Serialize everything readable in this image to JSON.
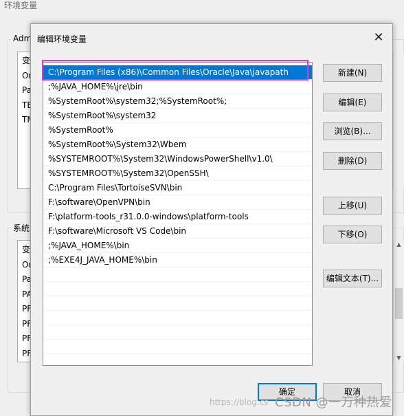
{
  "background_window": {
    "title": "环境变量",
    "user_group_label": "Adm",
    "user_list": [
      "变",
      "Or",
      "Pa",
      "TE",
      "TM"
    ],
    "system_group_label": "系统",
    "system_list": [
      "变",
      "Or",
      "Pa",
      "PA",
      "PF",
      "PF",
      "PF",
      "PF"
    ]
  },
  "dialog": {
    "title": "编辑环境变量",
    "close_glyph": "✕",
    "paths": [
      "C:\\Program Files (x86)\\Common Files\\Oracle\\Java\\javapath",
      ";%JAVA_HOME%\\jre\\bin",
      "%SystemRoot%\\system32;%SystemRoot%;",
      "%SystemRoot%\\system32",
      "%SystemRoot%",
      "%SystemRoot%\\System32\\Wbem",
      "%SYSTEMROOT%\\System32\\WindowsPowerShell\\v1.0\\",
      "%SYSTEMROOT%\\System32\\OpenSSH\\",
      "C:\\Program Files\\TortoiseSVN\\bin",
      "F:\\software\\OpenVPN\\bin",
      "F:\\platform-tools_r31.0.0-windows\\platform-tools",
      "F:\\software\\Microsoft VS Code\\bin",
      ";%JAVA_HOME%\\bin",
      ";%EXE4J_JAVA_HOME%\\bin",
      "",
      "",
      "",
      "",
      "",
      ""
    ],
    "buttons": {
      "new": "新建(N)",
      "edit": "编辑(E)",
      "browse": "浏览(B)...",
      "delete": "删除(D)",
      "move_up": "上移(U)",
      "move_down": "下移(O)",
      "edit_text": "编辑文本(T)...",
      "ok": "确定",
      "cancel": "取消"
    }
  },
  "watermark": {
    "url": "https://blog.cs",
    "text": "CSDN @一万种热爱"
  },
  "colors": {
    "selection": "#0078d7",
    "highlight_border": "#d83ad8"
  }
}
